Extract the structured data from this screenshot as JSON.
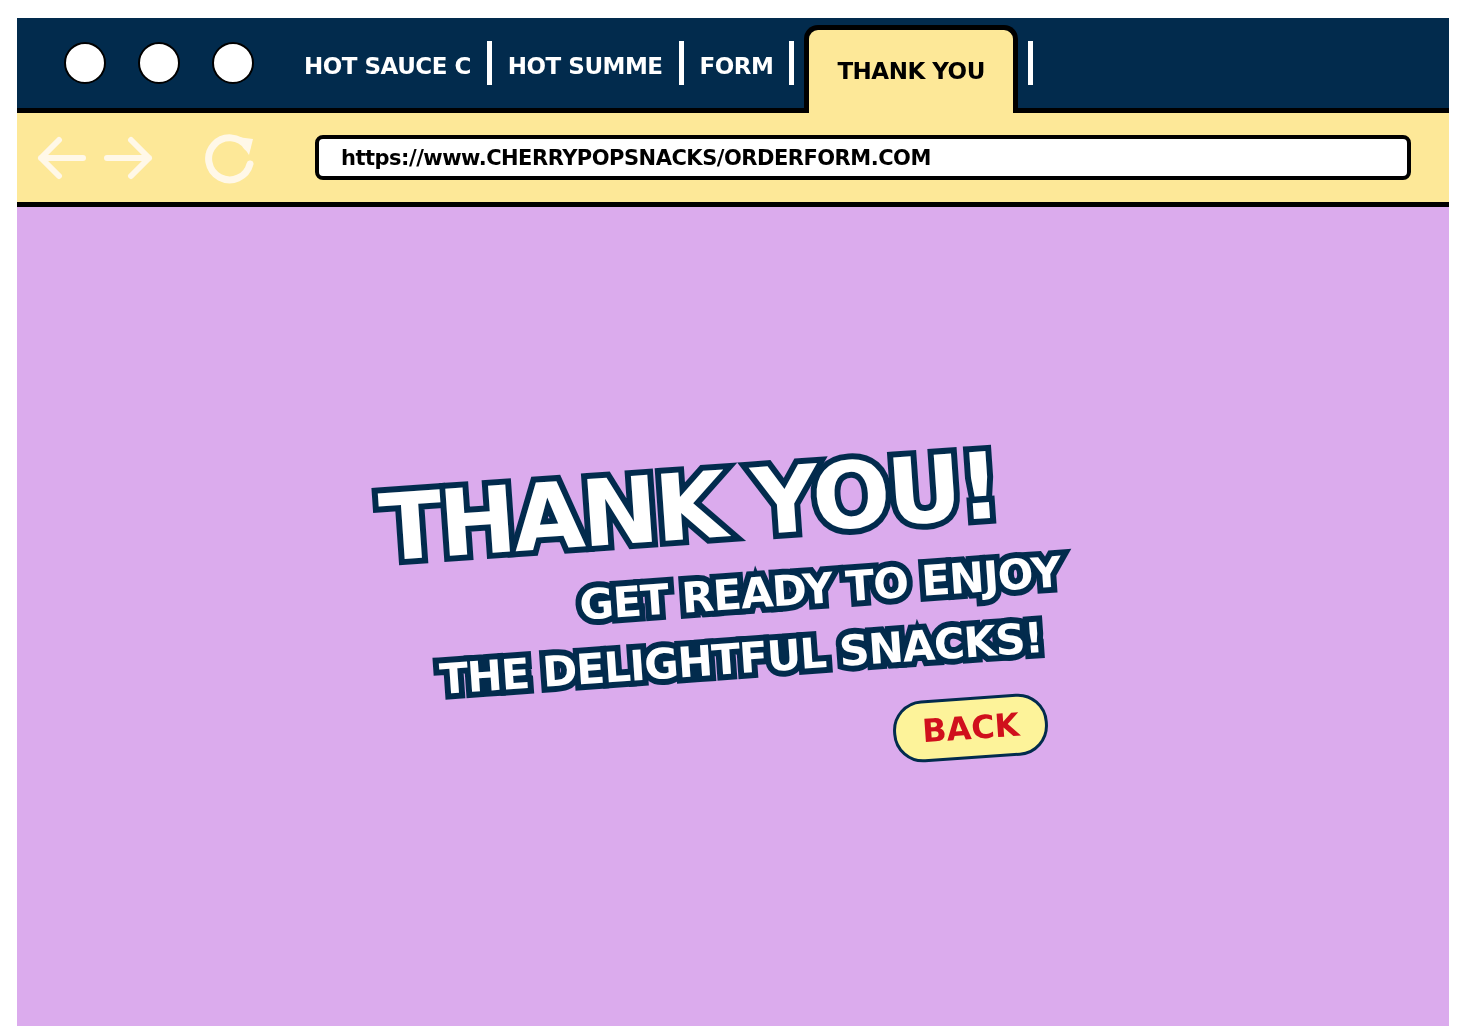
{
  "tabs": [
    {
      "label": "HOT SAUCE C",
      "selected": false
    },
    {
      "label": "HOT SUMME",
      "selected": false
    },
    {
      "label": "FORM",
      "selected": false
    },
    {
      "label": "THANK YOU",
      "selected": true
    }
  ],
  "address_bar": {
    "value": "https://www.CHERRYPOPSNACKS/ORDERFORM.COM"
  },
  "page": {
    "heading": "THANK YOU!",
    "lines": [
      "GET READY TO ENJOY",
      "THE DELIGHTFUL SNACKS!"
    ],
    "button": "BACK"
  }
}
